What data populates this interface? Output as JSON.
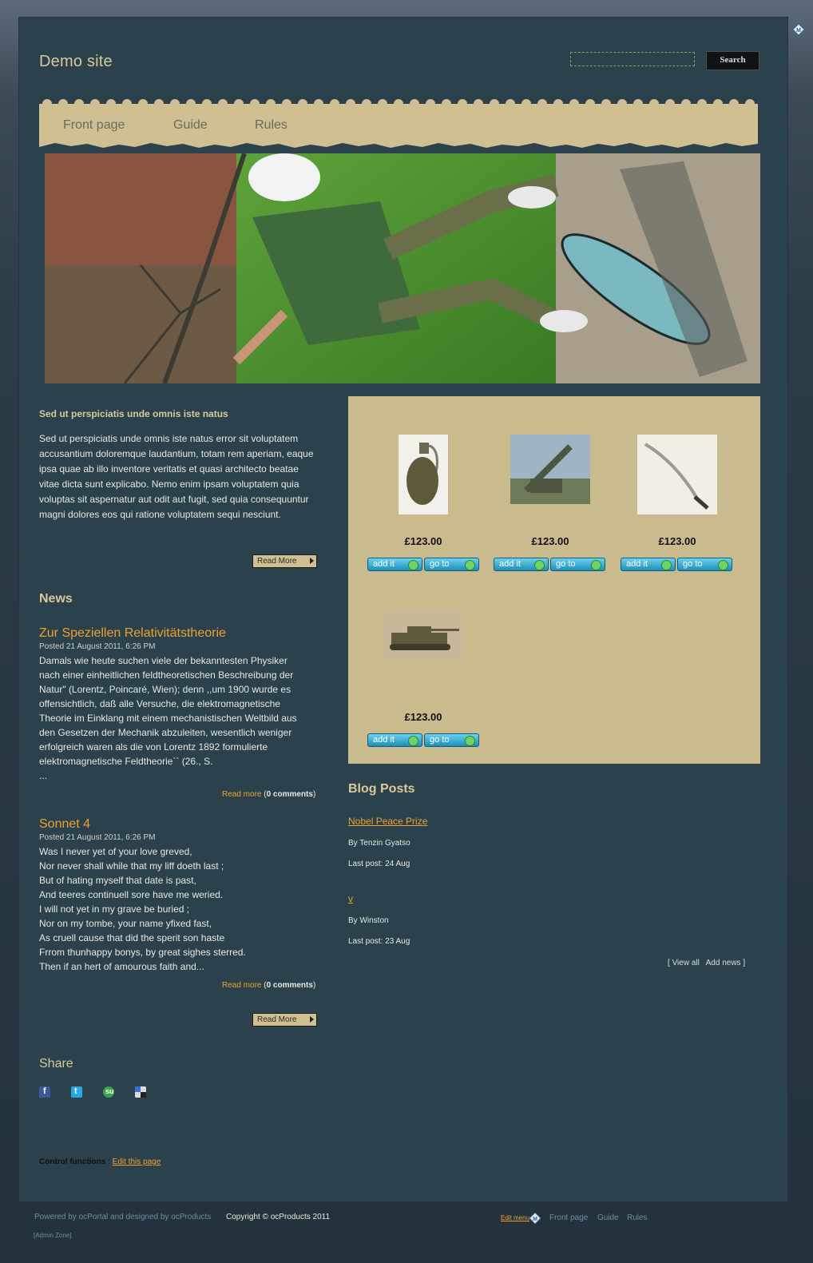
{
  "site": {
    "title": "Demo site"
  },
  "search": {
    "placeholder": "",
    "button_label": "Search"
  },
  "nav": {
    "items": [
      "Front page",
      "Guide",
      "Rules"
    ]
  },
  "intro": {
    "title": "Sed ut perspiciatis unde omnis iste natus",
    "text": "Sed ut perspiciatis unde omnis iste natus error sit voluptatem accusantium doloremque laudantium, totam rem aperiam, eaque ipsa quae ab illo inventore veritatis et quasi architecto beatae vitae dicta sunt explicabo. Nemo enim ipsam voluptatem quia voluptas sit aspernatur aut odit aut fugit, sed quia consequuntur magni dolores eos qui ratione voluptatem sequi nesciunt.",
    "read_more": "Read More"
  },
  "news": {
    "heading": "News",
    "items": [
      {
        "title": "Zur Speziellen Relativitätstheorie",
        "date": "Posted 21 August 2011, 6:26 PM",
        "lines": [
          "Damals wie heute suchen viele der bekanntesten Physiker",
          "nach einer einheitlichen feldtheoretischen Beschreibung der",
          "Natur\" (Lorentz, Poincaré, Wien); denn ,,um 1900 wurde es",
          "offensichtlich, daß alle Versuche, die elektromagnetische",
          "Theorie im Einklang mit einem mechanistischen Weltbild aus",
          "den Gesetzen der Mechanik abzuleiten, wesentlich weniger",
          "erfolgreich waren als die von Lorentz 1892 formulierte",
          "elektromagnetische Feldtheorie`` (26., S.",
          "..."
        ],
        "read_more": "Read more",
        "comments": "0 comments"
      },
      {
        "title": "Sonnet 4",
        "date": "Posted 21 August 2011, 6:26 PM",
        "lines": [
          "Was I never yet of your love greved,",
          "Nor never shall while that my liff doeth last ;",
          "But of hating myself that date is past,",
          "And teeres continuell sore have me weried.",
          "I will not yet in my grave be buried ;",
          "Nor on my tombe, your name yfixed fast,",
          "As cruell cause that did the sperit son haste",
          "Frrom thunhappy bonys, by great sighes sterred.",
          "Then if an hert of amourous faith and..."
        ],
        "read_more": "Read more",
        "comments": "0 comments"
      }
    ],
    "read_more_button": "Read More"
  },
  "share": {
    "heading": "Share",
    "icons": [
      "facebook-icon",
      "twitter-icon",
      "stumbleupon-icon",
      "delicious-icon"
    ]
  },
  "control": {
    "label": "Control functions",
    "separator": ":",
    "edit_link": "Edit this page"
  },
  "products": {
    "items": [
      {
        "image": "grenade",
        "price": "£123.00"
      },
      {
        "image": "missile-launcher",
        "price": "£123.00"
      },
      {
        "image": "sword",
        "price": "£123.00"
      },
      {
        "image": "tank",
        "price": "£123.00"
      }
    ],
    "add_label": "add it",
    "go_label": "go to"
  },
  "blog": {
    "heading": "Blog Posts",
    "posts": [
      {
        "title": "Nobel Peace Prize",
        "author": "By Tenzin Gyatso",
        "last_post": "Last post: 24 Aug"
      },
      {
        "title": "v",
        "author": "By Winston",
        "last_post": "Last post: 23 Aug"
      }
    ],
    "view_all": "View all",
    "add_news": "Add news",
    "bracket_open": "[",
    "bracket_close": "]"
  },
  "footer": {
    "powered": "Powered by ocPortal and designed by ocProducts",
    "copyright": "Copyright © ocProducts 2011",
    "edit_menu": "Edit menu",
    "nav": [
      "Front page",
      "Guide",
      "Rules"
    ],
    "admin_zone": "[Admin Zone]"
  },
  "colors": {
    "accent": "#f0a030",
    "panel": "#c9bb8d",
    "nav_bg": "#cfbf92",
    "page_bg": "#2b424c"
  }
}
